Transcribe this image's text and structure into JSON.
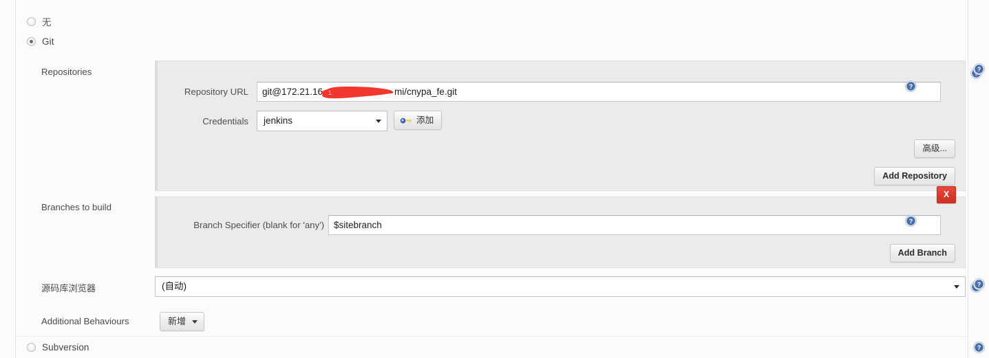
{
  "scm_options": [
    {
      "label": "无",
      "selected": false,
      "name": "none"
    },
    {
      "label": "Git",
      "selected": true,
      "name": "git"
    },
    {
      "label": "Subversion",
      "selected": false,
      "name": "subversion"
    }
  ],
  "git": {
    "repositories": {
      "label": "Repositories",
      "repository_url": {
        "label": "Repository URL",
        "value": "git@172.21.16                mi/cnypa_fe.git",
        "value_prefix": "git@172.21.16",
        "value_suffix": "mi/cnypa_fe.git",
        "redacted": true
      },
      "credentials": {
        "label": "Credentials",
        "value": "jenkins",
        "options": [
          "jenkins"
        ]
      },
      "add_credentials_button": "添加",
      "advanced_button": "高级...",
      "add_repository_button": "Add Repository"
    },
    "branches": {
      "label": "Branches to build",
      "branch_specifier": {
        "label": "Branch Specifier (blank for 'any')",
        "value": "$sitebranch"
      },
      "delete_button": "X",
      "add_branch_button": "Add Branch"
    },
    "repository_browser": {
      "label": "源码库浏览器",
      "value": "(自动)",
      "options": [
        "(自动)"
      ]
    },
    "additional_behaviours": {
      "label": "Additional Behaviours",
      "add_button": "新增"
    }
  },
  "help_icon": "help-question-icon",
  "colors": {
    "accent_red": "#e0392c",
    "redaction": "#f2372f",
    "panel_bg": "#ebebeb",
    "page_bg": "#fbfbfb",
    "help_blue": "#3b5a8c"
  }
}
